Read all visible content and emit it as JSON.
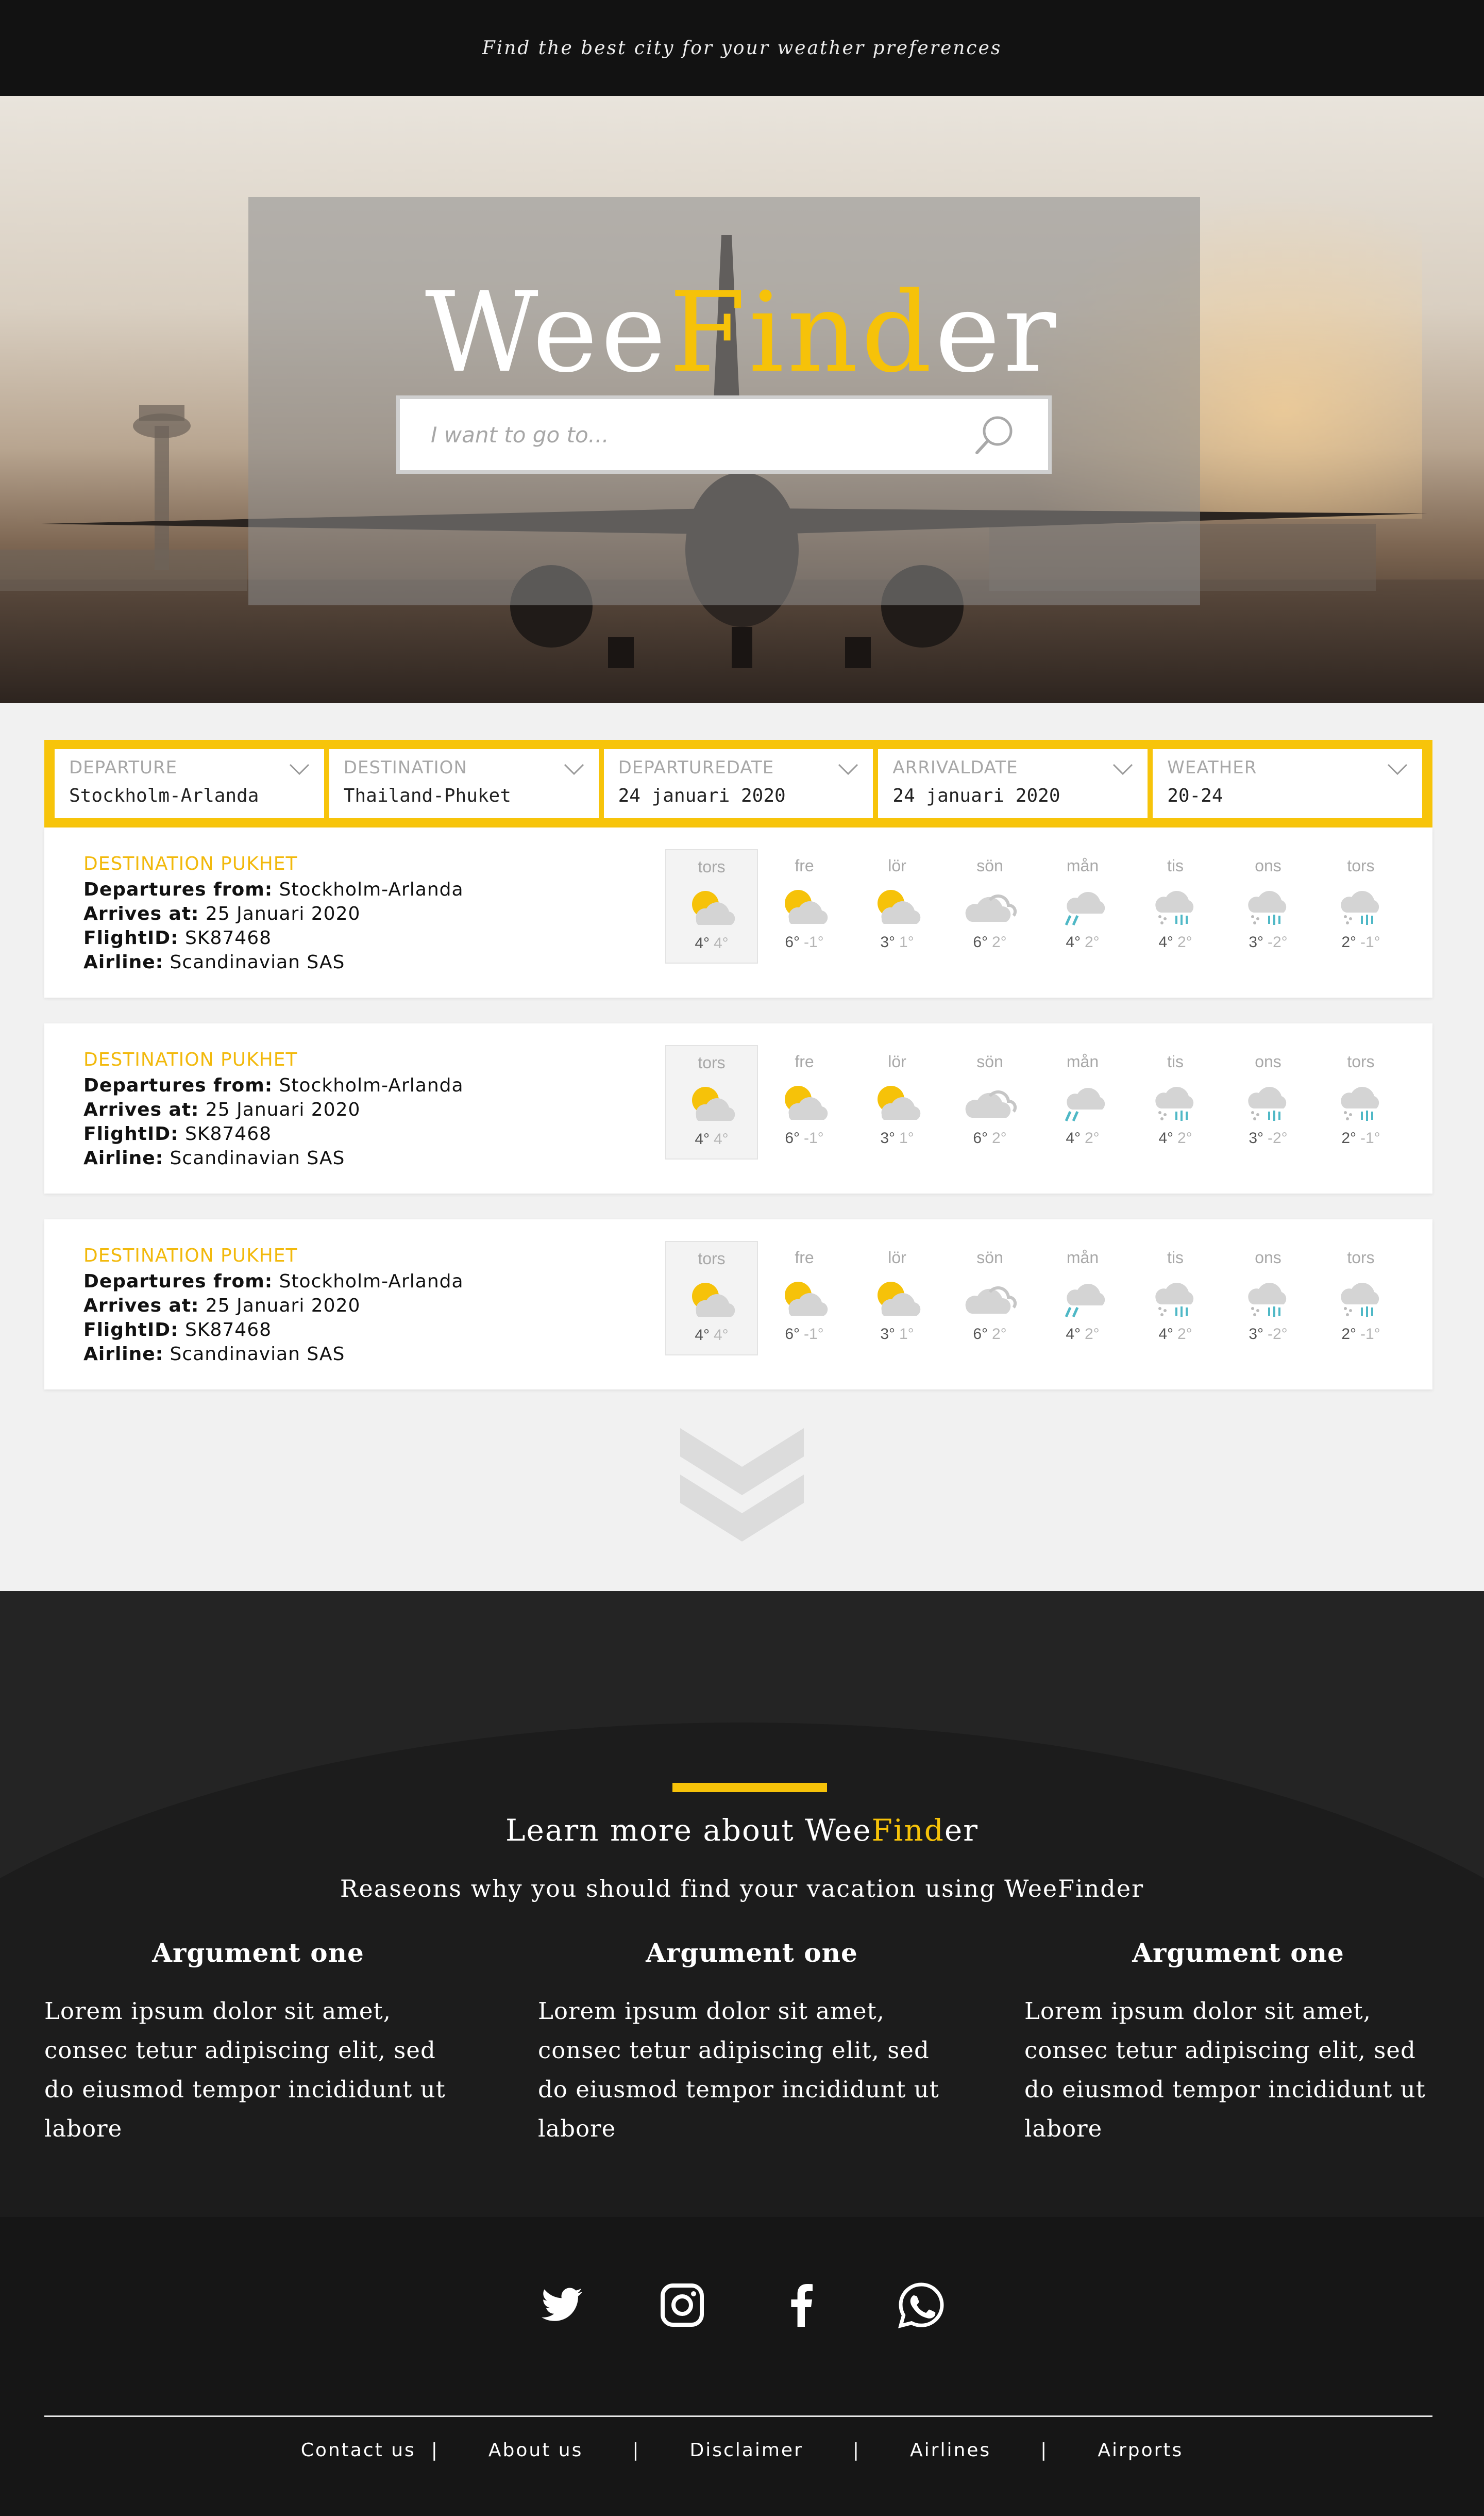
{
  "header": {
    "tagline": "Find the best city for your weather preferences"
  },
  "hero": {
    "logo_part1": "Wee",
    "logo_part2": "Find",
    "logo_part3": "er",
    "search_placeholder": "I want to go to..."
  },
  "filters": [
    {
      "label": "DEPARTURE",
      "value": "Stockholm-Arlanda"
    },
    {
      "label": "DESTINATION",
      "value": "Thailand-Phuket"
    },
    {
      "label": "DEPARTUREDATE",
      "value": "24 januari 2020"
    },
    {
      "label": "ARRIVALDATE",
      "value": "24 januari 2020"
    },
    {
      "label": "WEATHER",
      "value": "20-24"
    }
  ],
  "results": [
    {
      "destination": "DESTINATION PUKHET",
      "departs_label": "Departures from:",
      "departs": "Stockholm-Arlanda",
      "arrives_label": "Arrives at:",
      "arrives": "25 Januari 2020",
      "flight_label": "FlightID:",
      "flight": "SK87468",
      "airline_label": "Airline:",
      "airline": "Scandinavian SAS"
    },
    {
      "destination": "DESTINATION PUKHET",
      "departs_label": "Departures from:",
      "departs": "Stockholm-Arlanda",
      "arrives_label": "Arrives at:",
      "arrives": "25 Januari 2020",
      "flight_label": "FlightID:",
      "flight": "SK87468",
      "airline_label": "Airline:",
      "airline": "Scandinavian SAS"
    },
    {
      "destination": "DESTINATION PUKHET",
      "departs_label": "Departures from:",
      "departs": "Stockholm-Arlanda",
      "arrives_label": "Arrives at:",
      "arrives": "25 Januari 2020",
      "flight_label": "FlightID:",
      "flight": "SK87468",
      "airline_label": "Airline:",
      "airline": "Scandinavian SAS"
    }
  ],
  "forecast": [
    {
      "day": "tors",
      "icon": "sun-cloud-icon",
      "high": "4°",
      "low": "4°"
    },
    {
      "day": "fre",
      "icon": "sun-cloud-icon",
      "high": "6°",
      "low": "-1°"
    },
    {
      "day": "lör",
      "icon": "sun-cloud-icon",
      "high": "3°",
      "low": "1°"
    },
    {
      "day": "sön",
      "icon": "cloud-icon",
      "high": "6°",
      "low": "2°"
    },
    {
      "day": "mån",
      "icon": "rain-cloud-icon",
      "high": "4°",
      "low": "2°"
    },
    {
      "day": "tis",
      "icon": "snow-rain-cloud-icon",
      "high": "4°",
      "low": "2°"
    },
    {
      "day": "ons",
      "icon": "snow-rain-cloud-icon",
      "high": "3°",
      "low": "-2°"
    },
    {
      "day": "tors",
      "icon": "snow-rain-cloud-icon",
      "high": "2°",
      "low": "-1°"
    }
  ],
  "about": {
    "title_part1": "Learn more about Wee",
    "title_part2": "Find",
    "title_part3": "er",
    "subtitle": "Reaseons why you should find your vacation using WeeFinder",
    "arguments": [
      {
        "title": "Argument one",
        "text": "Lorem ipsum dolor sit amet, consec tetur adipiscing elit, sed do eiusmod tempor incididunt ut labore"
      },
      {
        "title": "Argument one",
        "text": "Lorem ipsum dolor sit amet, consec tetur adipiscing elit, sed do eiusmod tempor incididunt ut labore"
      },
      {
        "title": "Argument one",
        "text": "Lorem ipsum dolor sit amet, consec tetur adipiscing elit, sed do eiusmod tempor incididunt ut labore"
      }
    ]
  },
  "footer": {
    "social": [
      "twitter-icon",
      "instagram-icon",
      "facebook-icon",
      "whatsapp-icon"
    ],
    "links": [
      "Contact us",
      "About us",
      "Disclaimer",
      "Airlines",
      "Airports"
    ],
    "separator": "|"
  },
  "colors": {
    "accent": "#f6c209",
    "dark": "#121212",
    "card": "#ffffff"
  }
}
